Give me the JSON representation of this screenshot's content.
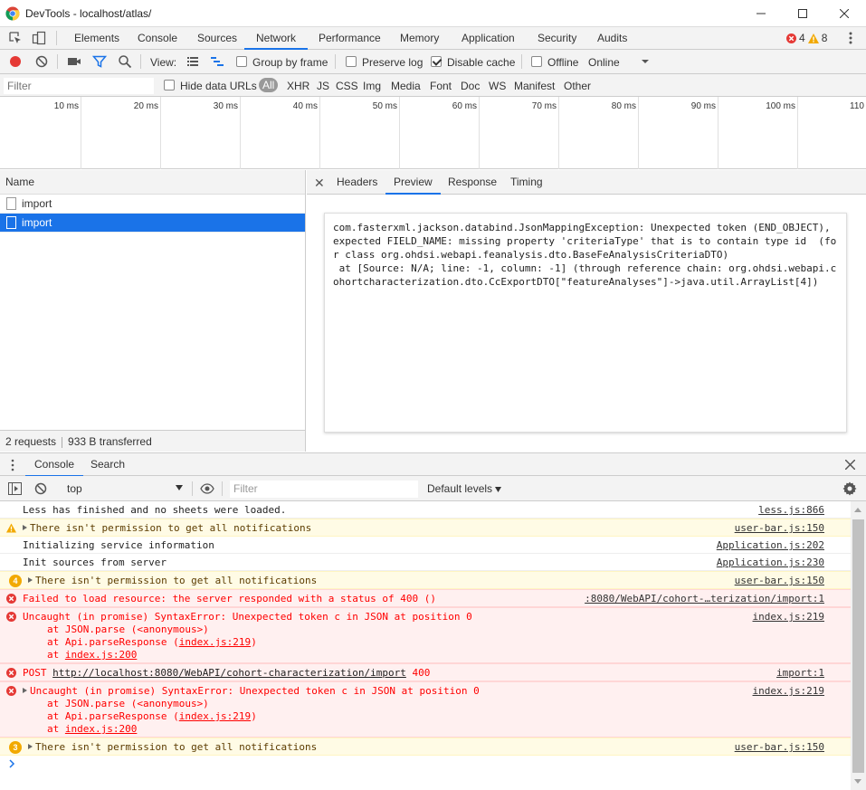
{
  "window": {
    "title": "DevTools - localhost/atlas/"
  },
  "tabs": [
    "Elements",
    "Console",
    "Sources",
    "Network",
    "Performance",
    "Memory",
    "Application",
    "Security",
    "Audits"
  ],
  "active_tab": "Network",
  "counts": {
    "errors": "4",
    "warnings": "8"
  },
  "network_toolbar": {
    "view_label": "View:",
    "group_by_frame": "Group by frame",
    "preserve_log": "Preserve log",
    "disable_cache": "Disable cache",
    "offline": "Offline",
    "throttle": "Online"
  },
  "filter_row": {
    "placeholder": "Filter",
    "hide_data_urls": "Hide data URLs",
    "types": [
      "All",
      "XHR",
      "JS",
      "CSS",
      "Img",
      "Media",
      "Font",
      "Doc",
      "WS",
      "Manifest",
      "Other"
    ]
  },
  "timeline_ticks": [
    "10 ms",
    "20 ms",
    "30 ms",
    "40 ms",
    "50 ms",
    "60 ms",
    "70 ms",
    "80 ms",
    "90 ms",
    "100 ms",
    "110"
  ],
  "requests": {
    "header": "Name",
    "rows": [
      "import",
      "import"
    ],
    "footer_requests": "2 requests",
    "footer_transferred": "933 B transferred"
  },
  "details": {
    "tabs": [
      "Headers",
      "Preview",
      "Response",
      "Timing"
    ],
    "active": "Preview",
    "preview_text": "com.fasterxml.jackson.databind.JsonMappingException: Unexpected token (END_OBJECT), expected FIELD_NAME: missing property 'criteriaType' that is to contain type id  (for class org.ohdsi.webapi.feanalysis.dto.BaseFeAnalysisCriteriaDTO)\n at [Source: N/A; line: -1, column: -1] (through reference chain: org.ohdsi.webapi.cohortcharacterization.dto.CcExportDTO[\"featureAnalyses\"]->java.util.ArrayList[4])"
  },
  "drawer": {
    "tabs": [
      "Console",
      "Search"
    ],
    "context": "top",
    "filter_placeholder": "Filter",
    "levels": "Default levels"
  },
  "console_messages": {
    "m1": {
      "text": "Less has finished and no sheets were loaded.",
      "source": "less.js:866"
    },
    "m2": {
      "text": "There isn't permission to get all notifications",
      "source": "user-bar.js:150"
    },
    "m3": {
      "text": "Initializing service information",
      "source": "Application.js:202"
    },
    "m4": {
      "text": "Init sources from server",
      "source": "Application.js:230"
    },
    "m5": {
      "badge": "4",
      "text": "There isn't permission to get all notifications",
      "source": "user-bar.js:150"
    },
    "m6": {
      "text": "Failed to load resource: the server responded with a status of 400 ()",
      "source": ":8080/WebAPI/cohort-…terization/import:1"
    },
    "m7": {
      "text": "Uncaught (in promise) SyntaxError: Unexpected token c in JSON at position 0",
      "l2": "at JSON.parse (<anonymous>)",
      "l3a": "at Api.parseResponse (",
      "l3link": "index.js:219",
      "l3b": ")",
      "l4a": "at ",
      "l4link": "index.js:200",
      "source": "index.js:219"
    },
    "m8": {
      "prefix": "POST ",
      "url": "http://localhost:8080/WebAPI/cohort-characterization/import",
      "suffix": " 400",
      "source": "import:1"
    },
    "m9": {
      "text": "Uncaught (in promise) SyntaxError: Unexpected token c in JSON at position 0",
      "l2": "at JSON.parse (<anonymous>)",
      "l3a": "at Api.parseResponse (",
      "l3link": "index.js:219",
      "l3b": ")",
      "l4a": "at ",
      "l4link": "index.js:200",
      "source": "index.js:219"
    },
    "m10": {
      "badge": "3",
      "text": "There isn't permission to get all notifications",
      "source": "user-bar.js:150"
    }
  },
  "colors": {
    "accent": "#1a73e8",
    "error": "#ff0000",
    "warning": "#f2a900"
  }
}
